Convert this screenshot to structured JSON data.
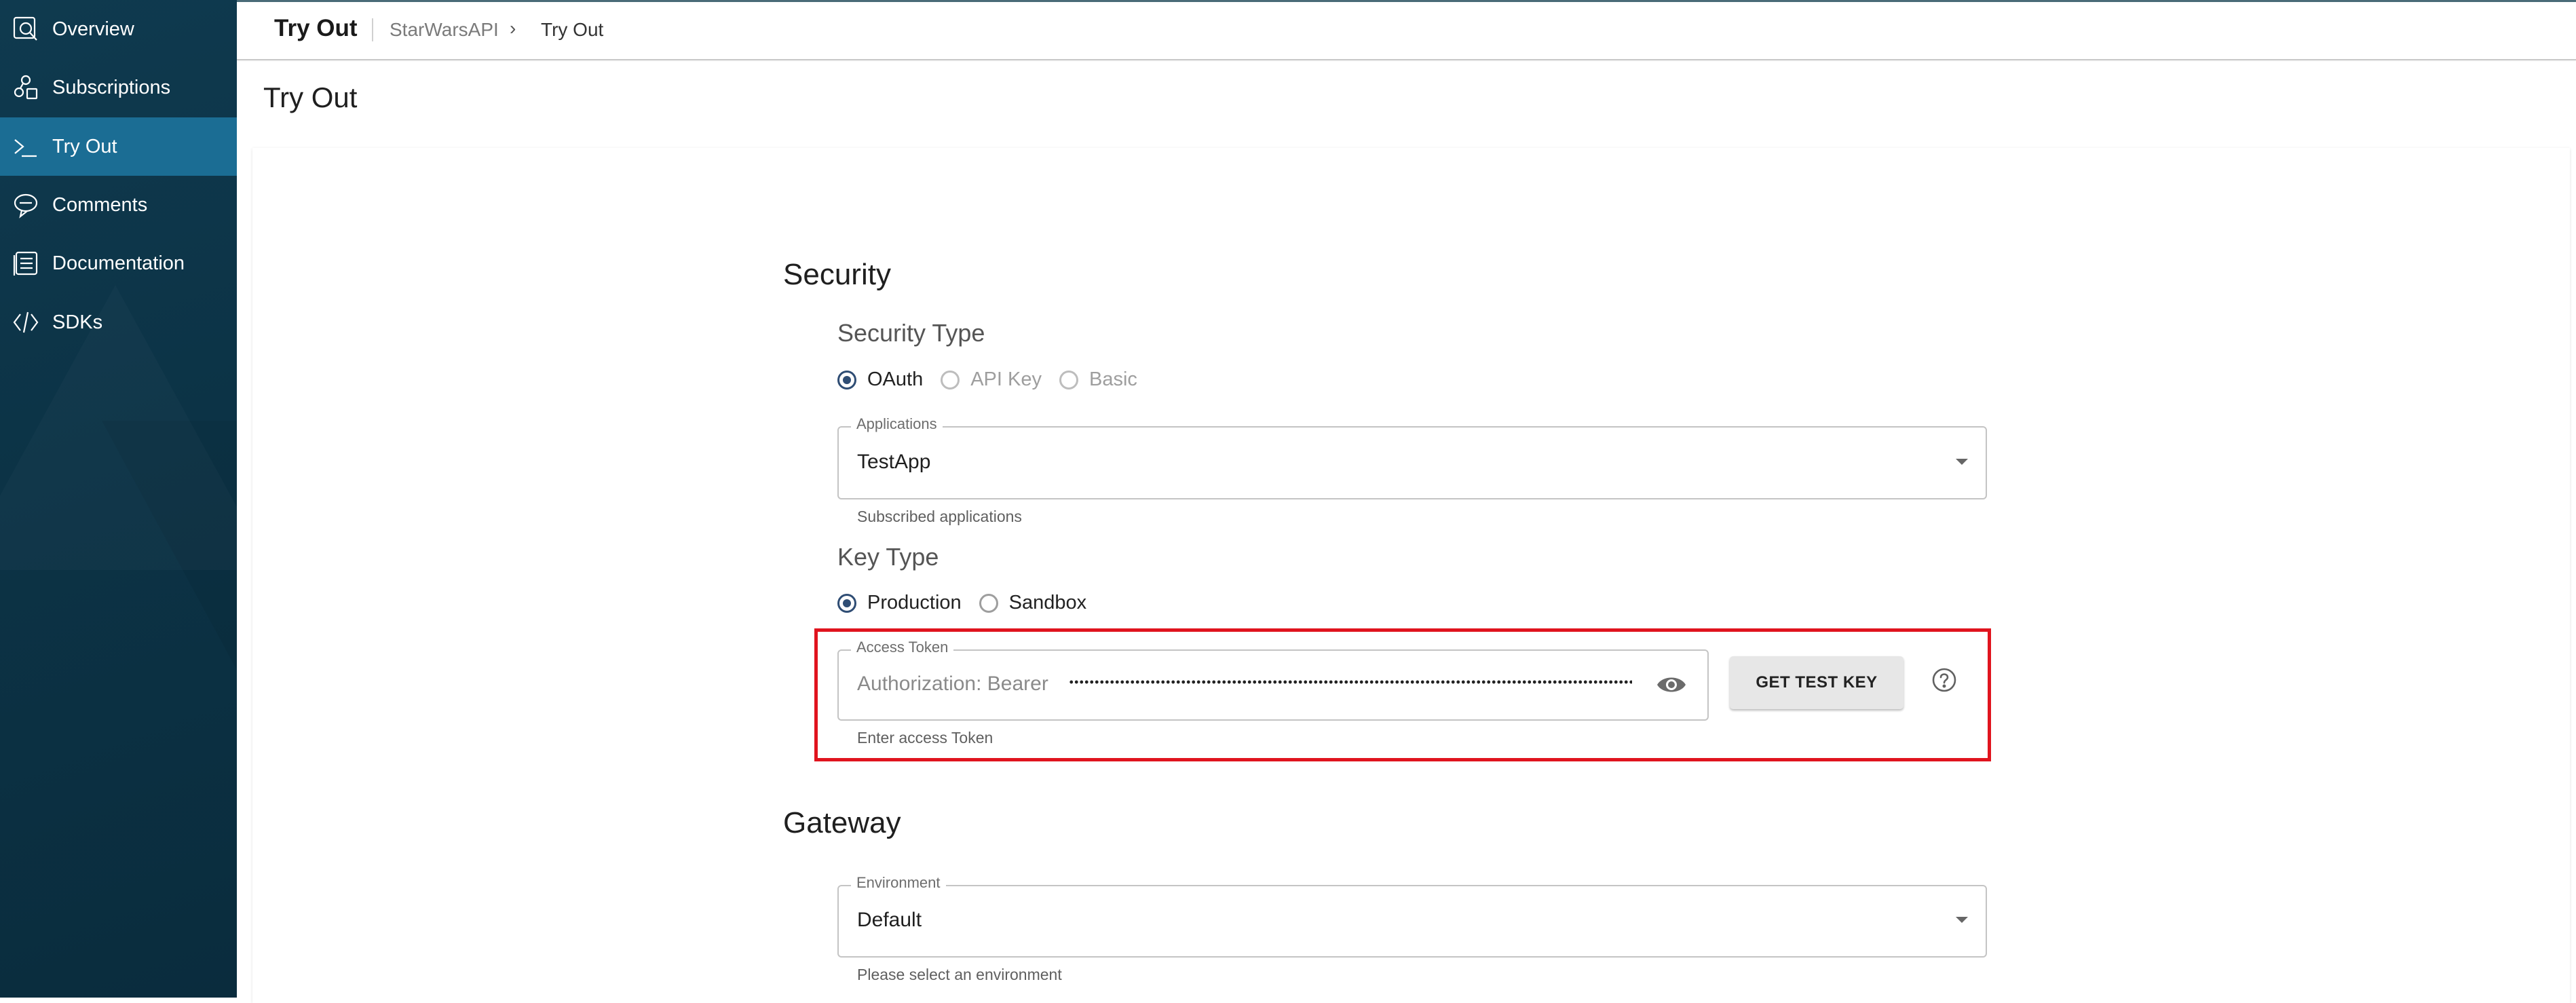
{
  "sidebar": {
    "items": [
      {
        "label": "Overview",
        "icon": "overview-icon"
      },
      {
        "label": "Subscriptions",
        "icon": "subscriptions-icon"
      },
      {
        "label": "Try Out",
        "icon": "terminal-icon",
        "active": true
      },
      {
        "label": "Comments",
        "icon": "comments-icon"
      },
      {
        "label": "Documentation",
        "icon": "documentation-icon"
      },
      {
        "label": "SDKs",
        "icon": "code-icon"
      }
    ],
    "colors": {
      "background": "#0c3346",
      "active": "#1b6d94"
    }
  },
  "header": {
    "title": "Try Out",
    "breadcrumb": [
      "StarWarsAPI",
      "Try Out"
    ]
  },
  "page": {
    "title": "Try Out"
  },
  "security": {
    "heading": "Security",
    "security_type_label": "Security Type",
    "security_types": [
      {
        "label": "OAuth",
        "selected": true,
        "disabled": false
      },
      {
        "label": "API Key",
        "selected": false,
        "disabled": true
      },
      {
        "label": "Basic",
        "selected": false,
        "disabled": true
      }
    ],
    "applications": {
      "label": "Applications",
      "value": "TestApp",
      "helper": "Subscribed applications"
    },
    "key_type_label": "Key Type",
    "key_types": [
      {
        "label": "Production",
        "selected": true
      },
      {
        "label": "Sandbox",
        "selected": false
      }
    ],
    "access_token": {
      "label": "Access Token",
      "prefix": "Authorization: Bearer",
      "helper": "Enter access Token",
      "masked": true
    },
    "get_test_key_label": "GET TEST KEY",
    "highlight_color": "#e0141e"
  },
  "gateway": {
    "heading": "Gateway",
    "environment": {
      "label": "Environment",
      "value": "Default",
      "helper": "Please select an environment"
    }
  }
}
